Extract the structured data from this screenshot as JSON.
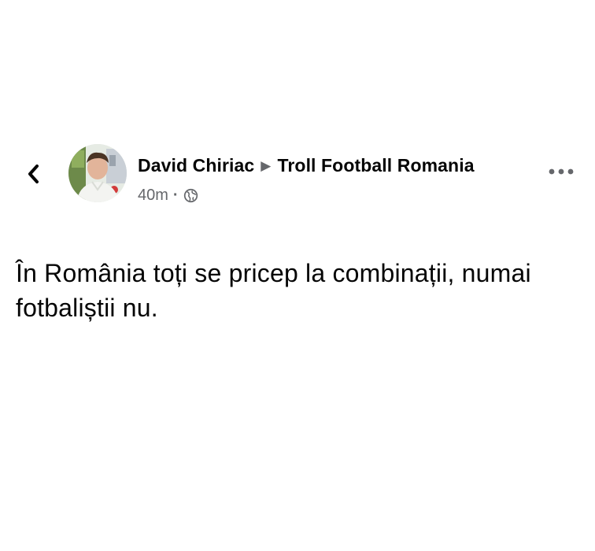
{
  "post": {
    "author": "David Chiriac",
    "group": "Troll Football Romania",
    "time": "40m",
    "separator": "·",
    "audience_icon": "globe-icon",
    "text": "În România toți se pricep la combinații, numai fotbaliștii nu."
  },
  "icons": {
    "back": "chevron-left-icon",
    "arrow": "triangle-right-icon",
    "more": "more-horizontal-icon"
  },
  "colors": {
    "text": "#050505",
    "secondary": "#65676b",
    "background": "#ffffff"
  }
}
